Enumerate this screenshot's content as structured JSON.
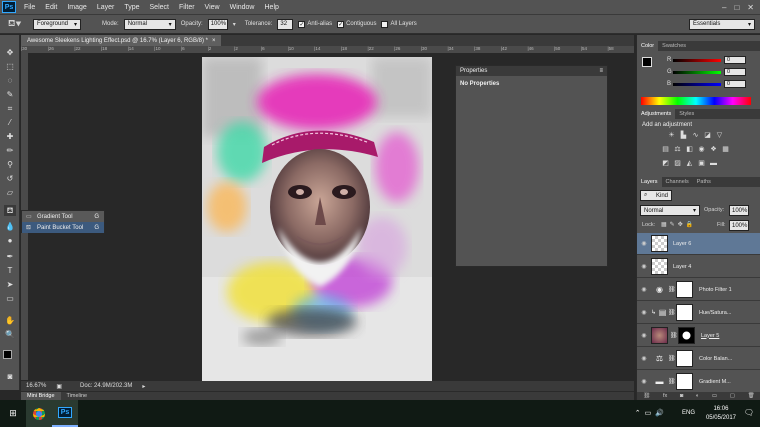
{
  "menubar": {
    "logo": "Ps",
    "items": [
      "File",
      "Edit",
      "Image",
      "Layer",
      "Type",
      "Select",
      "Filter",
      "View",
      "Window",
      "Help"
    ]
  },
  "options": {
    "fill_source": "Foreground",
    "mode_label": "Mode:",
    "mode_value": "Normal",
    "opacity_label": "Opacity:",
    "opacity_value": "100%",
    "tolerance_label": "Tolerance:",
    "tolerance_value": "32",
    "antialias_label": "Anti-alias",
    "contiguous_label": "Contiguous",
    "alllayers_label": "All Layers",
    "workspace": "Essentials"
  },
  "document": {
    "tab_title": "Awesome Sleekens Lighting Effect.psd @ 16.7% (Layer 6, RGB/8) *",
    "ruler_ticks": [
      "|30",
      "|26",
      "|22",
      "|18",
      "|14",
      "|10",
      "|6",
      "|2",
      "|2",
      "|6",
      "|10",
      "|14",
      "|18",
      "|22",
      "|26",
      "|30",
      "|34",
      "|38",
      "|42",
      "|46",
      "|50",
      "|54",
      "|58"
    ],
    "zoom": "16.67%",
    "doc_size": "Doc: 24.9M/202.3M"
  },
  "bottom_tabs": [
    "Mini Bridge",
    "Timeline"
  ],
  "flyout": {
    "items": [
      {
        "label": "Gradient Tool",
        "key": "G"
      },
      {
        "label": "Paint Bucket Tool",
        "key": "G"
      }
    ]
  },
  "properties": {
    "title": "Properties",
    "body": "No Properties"
  },
  "color_panel": {
    "tabs": [
      "Color",
      "Swatches"
    ],
    "channels": [
      {
        "label": "R",
        "value": "0"
      },
      {
        "label": "G",
        "value": "0"
      },
      {
        "label": "B",
        "value": "0"
      }
    ]
  },
  "adjustments_panel": {
    "tabs": [
      "Adjustments",
      "Styles"
    ],
    "heading": "Add an adjustment"
  },
  "layers_panel": {
    "tabs": [
      "Layers",
      "Channels",
      "Paths"
    ],
    "filter_kind": "Kind",
    "blend_mode": "Normal",
    "opacity_label": "Opacity:",
    "opacity_value": "100%",
    "lock_label": "Lock:",
    "fill_label": "Fill:",
    "fill_value": "100%",
    "layers": [
      {
        "name": "Layer 6",
        "selected": true
      },
      {
        "name": "Layer 4",
        "selected": false
      },
      {
        "name": "Photo Filter 1",
        "selected": false
      },
      {
        "name": "Hue/Satura...",
        "selected": false
      },
      {
        "name": "Layer 5",
        "selected": false
      },
      {
        "name": "Color Balan...",
        "selected": false
      },
      {
        "name": "Gradient M...",
        "selected": false
      }
    ]
  },
  "taskbar": {
    "language": "ENG",
    "time": "16:06",
    "date": "05/05/2017",
    "ps_label": "Ps"
  }
}
